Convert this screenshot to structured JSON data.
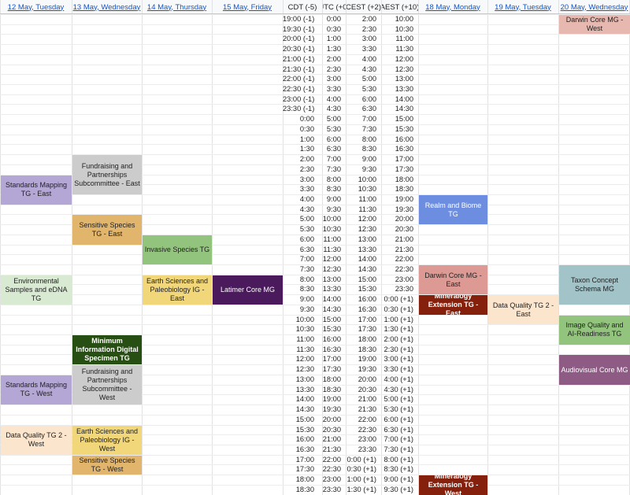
{
  "headers": {
    "day1": "12 May, Tuesday",
    "day2": "13 May, Wednesday",
    "day3": "14 May, Thursday",
    "day4": "15 May, Friday",
    "cdt": "CDT (-5)",
    "utc": "UTC (+0)",
    "cest": "CEST (+2)",
    "aest": "AEST (+10)",
    "day5": "18 May, Monday",
    "day6": "19 May, Tuesday",
    "day7": "20 May, Wednesday"
  },
  "times": [
    [
      "19:00 (-1)",
      "0:00",
      "2:00",
      "10:00"
    ],
    [
      "19:30 (-1)",
      "0:30",
      "2:30",
      "10:30"
    ],
    [
      "20:00 (-1)",
      "1:00",
      "3:00",
      "11:00"
    ],
    [
      "20:30 (-1)",
      "1:30",
      "3:30",
      "11:30"
    ],
    [
      "21:00 (-1)",
      "2:00",
      "4:00",
      "12:00"
    ],
    [
      "21:30 (-1)",
      "2:30",
      "4:30",
      "12:30"
    ],
    [
      "22:00 (-1)",
      "3:00",
      "5:00",
      "13:00"
    ],
    [
      "22:30 (-1)",
      "3:30",
      "5:30",
      "13:30"
    ],
    [
      "23:00 (-1)",
      "4:00",
      "6:00",
      "14:00"
    ],
    [
      "23:30 (-1)",
      "4:30",
      "6:30",
      "14:30"
    ],
    [
      "0:00",
      "5:00",
      "7:00",
      "15:00"
    ],
    [
      "0:30",
      "5:30",
      "7:30",
      "15:30"
    ],
    [
      "1:00",
      "6:00",
      "8:00",
      "16:00"
    ],
    [
      "1:30",
      "6:30",
      "8:30",
      "16:30"
    ],
    [
      "2:00",
      "7:00",
      "9:00",
      "17:00"
    ],
    [
      "2:30",
      "7:30",
      "9:30",
      "17:30"
    ],
    [
      "3:00",
      "8:00",
      "10:00",
      "18:00"
    ],
    [
      "3:30",
      "8:30",
      "10:30",
      "18:30"
    ],
    [
      "4:00",
      "9:00",
      "11:00",
      "19:00"
    ],
    [
      "4:30",
      "9:30",
      "11:30",
      "19:30"
    ],
    [
      "5:00",
      "10:00",
      "12:00",
      "20:00"
    ],
    [
      "5:30",
      "10:30",
      "12:30",
      "20:30"
    ],
    [
      "6:00",
      "11:00",
      "13:00",
      "21:00"
    ],
    [
      "6:30",
      "11:30",
      "13:30",
      "21:30"
    ],
    [
      "7:00",
      "12:00",
      "14:00",
      "22:00"
    ],
    [
      "7:30",
      "12:30",
      "14:30",
      "22:30"
    ],
    [
      "8:00",
      "13:00",
      "15:00",
      "23:00"
    ],
    [
      "8:30",
      "13:30",
      "15:30",
      "23:30"
    ],
    [
      "9:00",
      "14:00",
      "16:00",
      "0:00 (+1)"
    ],
    [
      "9:30",
      "14:30",
      "16:30",
      "0:30 (+1)"
    ],
    [
      "10:00",
      "15:00",
      "17:00",
      "1:00 (+1)"
    ],
    [
      "10:30",
      "15:30",
      "17:30",
      "1:30 (+1)"
    ],
    [
      "11:00",
      "16:00",
      "18:00",
      "2:00 (+1)"
    ],
    [
      "11:30",
      "16:30",
      "18:30",
      "2:30 (+1)"
    ],
    [
      "12:00",
      "17:00",
      "19:00",
      "3:00 (+1)"
    ],
    [
      "12:30",
      "17:30",
      "19:30",
      "3:30 (+1)"
    ],
    [
      "13:00",
      "18:00",
      "20:00",
      "4:00 (+1)"
    ],
    [
      "13:30",
      "18:30",
      "20:30",
      "4:30 (+1)"
    ],
    [
      "14:00",
      "19:00",
      "21:00",
      "5:00 (+1)"
    ],
    [
      "14:30",
      "19:30",
      "21:30",
      "5:30 (+1)"
    ],
    [
      "15:00",
      "20:00",
      "22:00",
      "6:00 (+1)"
    ],
    [
      "15:30",
      "20:30",
      "22:30",
      "6:30 (+1)"
    ],
    [
      "16:00",
      "21:00",
      "23:00",
      "7:00 (+1)"
    ],
    [
      "16:30",
      "21:30",
      "23:30",
      "7:30 (+1)"
    ],
    [
      "17:00",
      "22:00",
      "0:00 (+1)",
      "8:00 (+1)"
    ],
    [
      "17:30",
      "22:30",
      "0:30 (+1)",
      "8:30 (+1)"
    ],
    [
      "18:00",
      "23:00",
      "1:00 (+1)",
      "9:00 (+1)"
    ],
    [
      "18:30",
      "23:30",
      "1:30 (+1)",
      "9:30 (+1)"
    ]
  ],
  "events": [
    {
      "day": 6,
      "start": 0,
      "span": 2,
      "label": "Darwin Core MG - West",
      "bg": "#e6b8af",
      "fg": "#222222",
      "bold": false
    },
    {
      "day": 1,
      "start": 14,
      "span": 4,
      "label": "Fundraising and Partnerships Subcommittee - East",
      "bg": "#cccccc",
      "fg": "#222222",
      "bold": false
    },
    {
      "day": 0,
      "start": 16,
      "span": 3,
      "label": "Standards Mapping TG - East",
      "bg": "#b4a7d6",
      "fg": "#222222",
      "bold": false
    },
    {
      "day": 4,
      "start": 18,
      "span": 3,
      "label": "Realm and Biome TG",
      "bg": "#6d8ee0",
      "fg": "#ffffff",
      "bold": false
    },
    {
      "day": 1,
      "start": 20,
      "span": 3,
      "label": "Sensitive Species TG - East",
      "bg": "#e2b56c",
      "fg": "#222222",
      "bold": false
    },
    {
      "day": 2,
      "start": 22,
      "span": 3,
      "label": "Invasive Species TG",
      "bg": "#93c47d",
      "fg": "#222222",
      "bold": false
    },
    {
      "day": 0,
      "start": 26,
      "span": 3,
      "label": "Environmental Samples and eDNA TG",
      "bg": "#d9ead3",
      "fg": "#222222",
      "bold": false
    },
    {
      "day": 2,
      "start": 26,
      "span": 3,
      "label": "Earth Sciences and Paleobiology IG - East",
      "bg": "#f1d77a",
      "fg": "#222222",
      "bold": false
    },
    {
      "day": 3,
      "start": 26,
      "span": 3,
      "label": "Latimer Core MG",
      "bg": "#4a1a5c",
      "fg": "#ffffff",
      "bold": false
    },
    {
      "day": 4,
      "start": 25,
      "span": 3,
      "label": "Darwin Core MG - East",
      "bg": "#dd9a94",
      "fg": "#222222",
      "bold": false
    },
    {
      "day": 6,
      "start": 25,
      "span": 4,
      "label": "Taxon Concept Schema MG",
      "bg": "#a2c4c9",
      "fg": "#222222",
      "bold": false
    },
    {
      "day": 4,
      "start": 28,
      "span": 2,
      "label": "Mineralogy Extension TG - East",
      "bg": "#85200c",
      "fg": "#ffffff",
      "bold": true
    },
    {
      "day": 5,
      "start": 28,
      "span": 3,
      "label": "Data Quality TG 2 - East",
      "bg": "#fce5cd",
      "fg": "#222222",
      "bold": false
    },
    {
      "day": 6,
      "start": 30,
      "span": 3,
      "label": "Image Quality and AI-Readiness TG",
      "bg": "#93c47d",
      "fg": "#222222",
      "bold": false
    },
    {
      "day": 1,
      "start": 32,
      "span": 3,
      "label": "Minimum Information Digital Specimen TG",
      "bg": "#274e13",
      "fg": "#ffffff",
      "bold": true
    },
    {
      "day": 6,
      "start": 34,
      "span": 3,
      "label": "Audiovisual Core MG",
      "bg": "#8e5b85",
      "fg": "#ffffff",
      "bold": false
    },
    {
      "day": 1,
      "start": 35,
      "span": 4,
      "label": "Fundraising and Partnerships Subcommittee - West",
      "bg": "#cccccc",
      "fg": "#222222",
      "bold": false
    },
    {
      "day": 0,
      "start": 36,
      "span": 3,
      "label": "Standards Mapping TG - West",
      "bg": "#b4a7d6",
      "fg": "#222222",
      "bold": false
    },
    {
      "day": 0,
      "start": 41,
      "span": 3,
      "label": "Data Quality TG 2 - West",
      "bg": "#fce5cd",
      "fg": "#222222",
      "bold": false
    },
    {
      "day": 1,
      "start": 41,
      "span": 3,
      "label": "Earth Sciences and Paleobiology IG - West",
      "bg": "#f1d77a",
      "fg": "#222222",
      "bold": false
    },
    {
      "day": 1,
      "start": 44,
      "span": 2,
      "label": "Sensitive Species TG - West",
      "bg": "#e2b56c",
      "fg": "#222222",
      "bold": false
    },
    {
      "day": 4,
      "start": 46,
      "span": 2,
      "label": "Mineralogy Extension TG - West",
      "bg": "#85200c",
      "fg": "#ffffff",
      "bold": true
    }
  ]
}
